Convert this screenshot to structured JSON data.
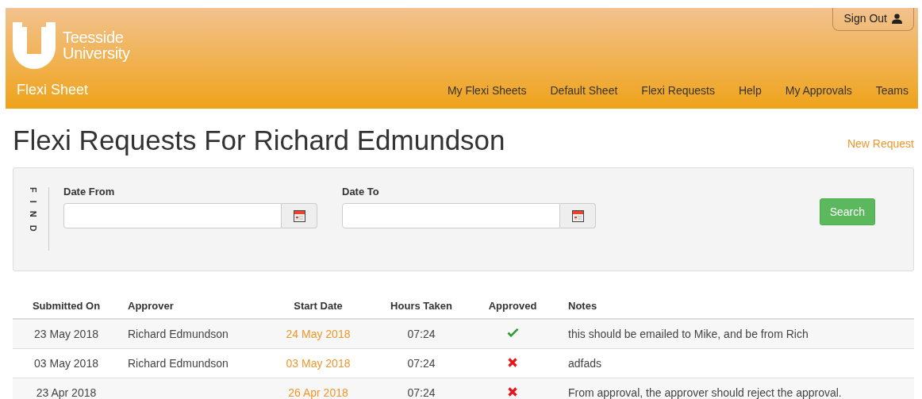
{
  "header": {
    "logo_line_1": "Teesside",
    "logo_line_2": "University",
    "app_name": "Flexi Sheet",
    "sign_out": "Sign Out",
    "nav": [
      "My Flexi Sheets",
      "Default Sheet",
      "Flexi Requests",
      "Help",
      "My Approvals",
      "Teams"
    ]
  },
  "page": {
    "title": "Flexi Requests For Richard Edmundson",
    "new_request": "New Request"
  },
  "find": {
    "label": "FIND",
    "fields": [
      {
        "label": "Date From"
      },
      {
        "label": "Date To"
      }
    ],
    "button": "Search"
  },
  "table": {
    "columns": [
      "Submitted On",
      "Approver",
      "Start Date",
      "Hours Taken",
      "Approved",
      "Notes"
    ],
    "rows": [
      {
        "submitted": "23 May 2018",
        "approver": "Richard Edmundson",
        "start": "24 May 2018",
        "hours": "07:24",
        "approved": true,
        "notes": "this should be emailed to Mike, and be from Rich"
      },
      {
        "submitted": "03 May 2018",
        "approver": "Richard Edmundson",
        "start": "03 May 2018",
        "hours": "07:24",
        "approved": false,
        "notes": "adfads"
      },
      {
        "submitted": "23 Apr 2018",
        "start": "26 Apr 2018",
        "hours": "07:24",
        "approved": false,
        "notes": "From approval, the approver should reject the approval."
      }
    ]
  }
}
